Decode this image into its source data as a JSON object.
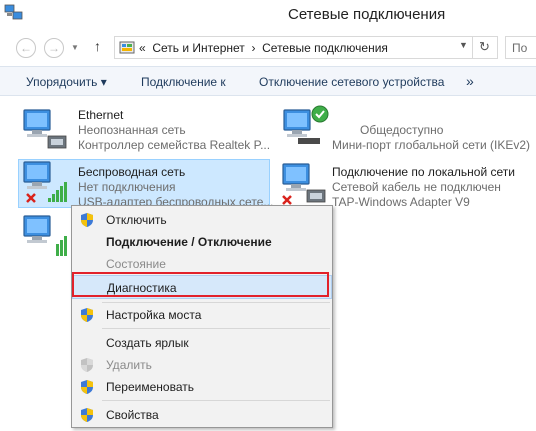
{
  "window": {
    "title": "Сетевые подключения"
  },
  "address_bar": {
    "prefix": "«",
    "crumbs": [
      "Сеть и Интернет",
      "Сетевые подключения"
    ],
    "separator": "›"
  },
  "search": {
    "placeholder": "По"
  },
  "toolbar": {
    "organize": "Упорядочить ▾",
    "connect_to": "Подключение к",
    "disable_device": "Отключение сетевого устройства",
    "more": "»"
  },
  "connections": [
    {
      "name": "Ethernet",
      "status": "Неопознанная сеть",
      "device": "Контроллер семейства Realtek P..."
    },
    {
      "name": "",
      "status": "Общедоступно",
      "device": "Мини-порт глобальной сети (IKEv2)"
    },
    {
      "name": "Беспроводная сеть",
      "status": "Нет подключения",
      "device": "USB-адаптер беспроводных сете..."
    },
    {
      "name": "Подключение по локальной сети",
      "status": "Сетевой кабель не подключен",
      "device": "TAP-Windows Adapter V9"
    }
  ],
  "context_menu": {
    "disable": "Отключить",
    "connect_disconnect": "Подключение / Отключение",
    "status": "Состояние",
    "diagnose": "Диагностика",
    "bridge": "Настройка моста",
    "shortcut": "Создать ярлык",
    "delete": "Удалить",
    "rename": "Переименовать",
    "properties": "Свойства"
  },
  "colors": {
    "highlight_border": "#e2212a",
    "selection_bg": "#cde8ff",
    "toolbar_bg": "#f3f6fb"
  }
}
